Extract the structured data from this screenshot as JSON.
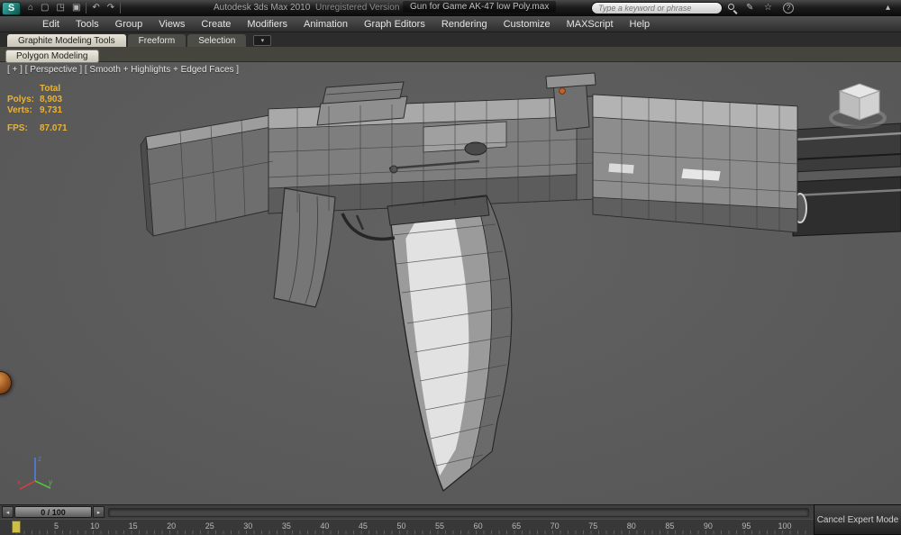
{
  "window": {
    "app_title": "Autodesk 3ds Max 2010",
    "license": "Unregistered Version",
    "document_title": "Gun for Game AK-47 low Poly.max",
    "search_placeholder": "Type a keyword or phrase"
  },
  "titlebar_icons": {
    "logo": "S",
    "home": "⌂",
    "new": "▢",
    "open": "◳",
    "save": "▣",
    "undo": "↶",
    "redo": "↷",
    "pen": "✎",
    "star": "☆",
    "help": "?",
    "chevron_up": "▴"
  },
  "menu": {
    "items": [
      "Edit",
      "Tools",
      "Group",
      "Views",
      "Create",
      "Modifiers",
      "Animation",
      "Graph Editors",
      "Rendering",
      "Customize",
      "MAXScript",
      "Help"
    ]
  },
  "ribbon": {
    "tabs": [
      "Graphite Modeling Tools",
      "Freeform",
      "Selection"
    ],
    "collapse_icon": "▾",
    "panel_button": "Polygon Modeling"
  },
  "viewport": {
    "label": "[ + ] [ Perspective ] [ Smooth + Highlights + Edged Faces ]",
    "model_name": "AK-47 low poly rifle",
    "stats": {
      "total_label": "Total",
      "polys_label": "Polys:",
      "polys_value": "8,903",
      "verts_label": "Verts:",
      "verts_value": "9,731",
      "fps_label": "FPS:",
      "fps_value": "87.071"
    }
  },
  "timeline": {
    "slider_value": "0 / 100",
    "prev_icon": "◂",
    "next_icon": "▸",
    "ticks": [
      0,
      5,
      10,
      15,
      20,
      25,
      30,
      35,
      40,
      45,
      50,
      55,
      60,
      65,
      70,
      75,
      80,
      85,
      90,
      95,
      100
    ]
  },
  "statusbar": {
    "expert_button": "Cancel Expert Mode"
  },
  "colors": {
    "stats_text": "#e8b33a",
    "viewport_bg": "#5d5d5d",
    "sight_dot": "#c2622b"
  }
}
